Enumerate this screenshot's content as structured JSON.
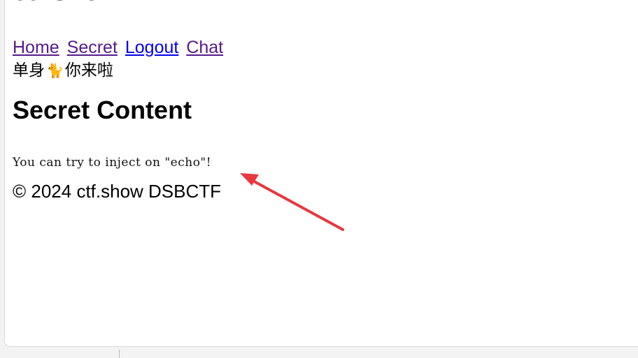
{
  "site": {
    "title": "ctf.show"
  },
  "nav": {
    "items": [
      {
        "label": "Home"
      },
      {
        "label": "Secret"
      },
      {
        "label": "Logout"
      },
      {
        "label": "Chat"
      }
    ]
  },
  "greeting": {
    "before": "单身",
    "emoji": "🐈",
    "after": "你来啦"
  },
  "content": {
    "heading": "Secret Content",
    "message": "You can try to inject on \"echo\"!"
  },
  "footer": {
    "text": "© 2024 ctf.show DSBCTF"
  },
  "colors": {
    "visited_link": "#551a8b",
    "link": "#0000ee",
    "annotation_arrow": "#e8383d"
  }
}
